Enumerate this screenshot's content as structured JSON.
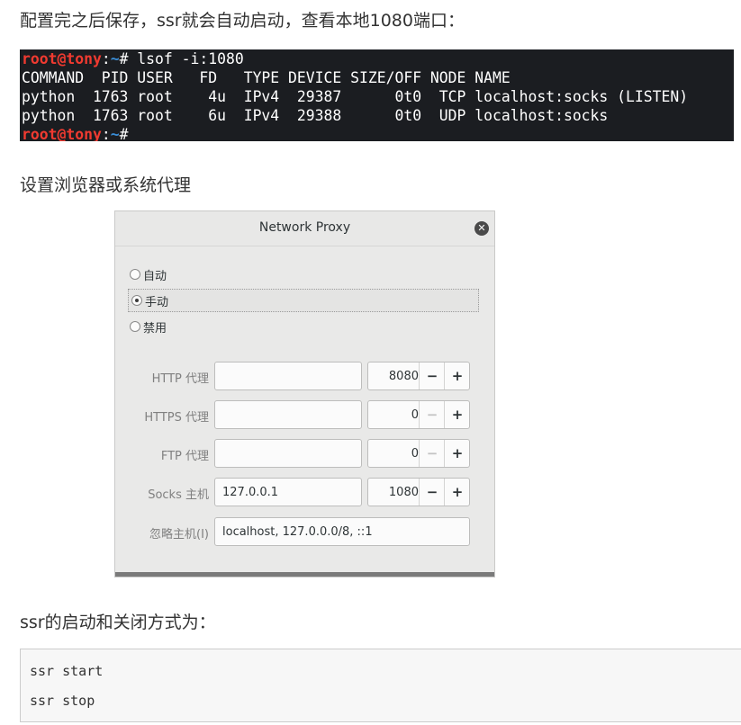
{
  "intro_text": "配置完之后保存，ssr就会自动启动，查看本地1080端口：",
  "terminal": {
    "prompt_user": "root@tony",
    "prompt_sep": ":",
    "prompt_path": "~",
    "prompt_sym": "#",
    "command": " lsof -i:1080",
    "lines": [
      "COMMAND  PID USER   FD   TYPE DEVICE SIZE/OFF NODE NAME",
      "python  1763 root    4u  IPv4  29387      0t0  TCP localhost:socks (LISTEN)",
      "python  1763 root    6u  IPv4  29388      0t0  UDP localhost:socks"
    ],
    "final_prompt_suffix": ""
  },
  "proxy_text": "设置浏览器或系统代理",
  "dialog": {
    "title": "Network Proxy",
    "modes": [
      "自动",
      "手动",
      "禁用"
    ],
    "selected_mode": "手动",
    "http": {
      "label": "HTTP 代理",
      "host": "",
      "port": "8080"
    },
    "https": {
      "label": "HTTPS 代理",
      "host": "",
      "port": "0"
    },
    "ftp": {
      "label": "FTP 代理",
      "host": "",
      "port": "0"
    },
    "socks": {
      "label": "Socks 主机",
      "host": "127.0.0.1",
      "port": "1080"
    },
    "ignore": {
      "label": "忽略主机(I)",
      "value": "localhost, 127.0.0.0/8, ::1"
    },
    "minus_symbol": "−",
    "plus_symbol": "+",
    "close_symbol": "✕"
  },
  "start_stop_text": "ssr的启动和关闭方式为：",
  "code": {
    "line1": "ssr start",
    "line2": "ssr stop"
  }
}
